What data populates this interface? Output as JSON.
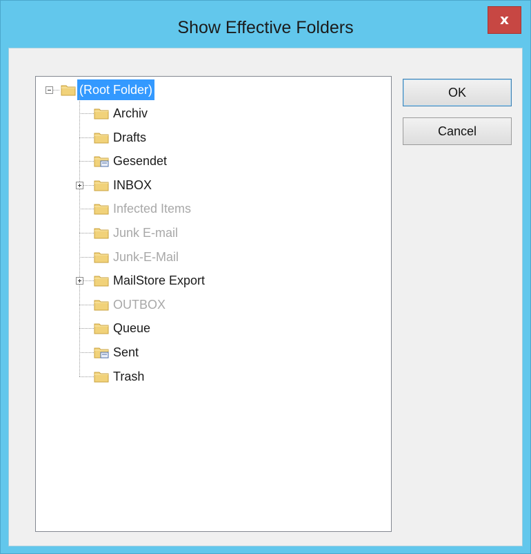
{
  "window": {
    "title": "Show Effective Folders",
    "close_label": "x"
  },
  "buttons": {
    "ok": "OK",
    "cancel": "Cancel"
  },
  "tree": {
    "root": {
      "label": "(Root Folder)",
      "state": "selected",
      "expanded": true
    },
    "children": [
      {
        "label": "Archiv",
        "state": "normal",
        "icon": "folder-icon",
        "expandable": false
      },
      {
        "label": "Drafts",
        "state": "normal",
        "icon": "folder-icon",
        "expandable": false
      },
      {
        "label": "Gesendet",
        "state": "normal",
        "icon": "sent-folder-icon",
        "expandable": false
      },
      {
        "label": "INBOX",
        "state": "normal",
        "icon": "folder-icon",
        "expandable": true
      },
      {
        "label": "Infected Items",
        "state": "disabled",
        "icon": "folder-icon",
        "expandable": false
      },
      {
        "label": "Junk E-mail",
        "state": "disabled",
        "icon": "folder-icon",
        "expandable": false
      },
      {
        "label": "Junk-E-Mail",
        "state": "disabled",
        "icon": "folder-icon",
        "expandable": false
      },
      {
        "label": "MailStore Export",
        "state": "normal",
        "icon": "folder-icon",
        "expandable": true
      },
      {
        "label": "OUTBOX",
        "state": "disabled",
        "icon": "folder-icon",
        "expandable": false
      },
      {
        "label": "Queue",
        "state": "normal",
        "icon": "folder-icon",
        "expandable": false
      },
      {
        "label": "Sent",
        "state": "normal",
        "icon": "sent-folder-icon",
        "expandable": false
      },
      {
        "label": "Trash",
        "state": "normal",
        "icon": "folder-icon",
        "expandable": false
      }
    ]
  },
  "colors": {
    "titlebar": "#62c7ec",
    "close": "#c74743",
    "selection": "#3399ff",
    "disabled_text": "#a8a8a8"
  }
}
